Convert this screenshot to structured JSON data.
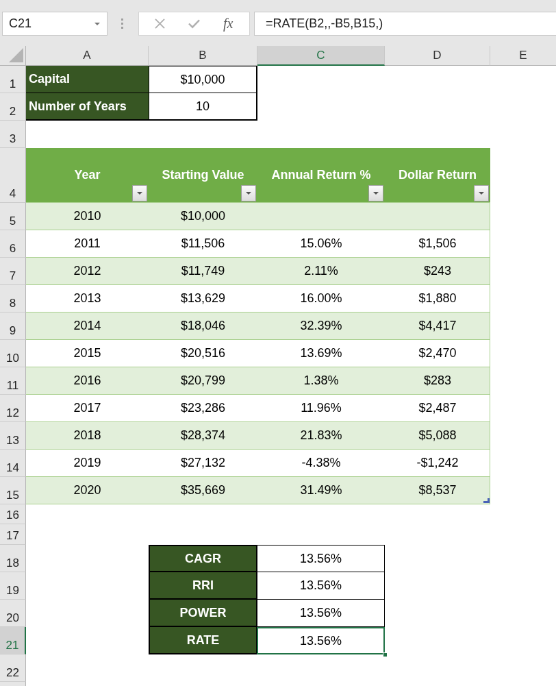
{
  "name_box": {
    "value": "C21"
  },
  "formula_buttons": [
    {
      "kind": "cancel",
      "disabled": true
    },
    {
      "kind": "enter",
      "disabled": true
    },
    {
      "kind": "function",
      "label": "fx",
      "disabled": false
    }
  ],
  "formula_bar": {
    "value": "=RATE(B2,,-B5,B15,)"
  },
  "columns": [
    {
      "label": "A",
      "selected": false
    },
    {
      "label": "B",
      "selected": false
    },
    {
      "label": "C",
      "selected": true
    },
    {
      "label": "D",
      "selected": false
    },
    {
      "label": "E",
      "selected": false
    }
  ],
  "row_headers": [
    {
      "label": "1",
      "selected": false
    },
    {
      "label": "2",
      "selected": false
    },
    {
      "label": "3",
      "selected": false
    },
    {
      "label": "4",
      "selected": false
    },
    {
      "label": "5",
      "selected": false
    },
    {
      "label": "6",
      "selected": false
    },
    {
      "label": "7",
      "selected": false
    },
    {
      "label": "8",
      "selected": false
    },
    {
      "label": "9",
      "selected": false
    },
    {
      "label": "10",
      "selected": false
    },
    {
      "label": "11",
      "selected": false
    },
    {
      "label": "12",
      "selected": false
    },
    {
      "label": "13",
      "selected": false
    },
    {
      "label": "14",
      "selected": false
    },
    {
      "label": "15",
      "selected": false
    },
    {
      "label": "16",
      "selected": false
    },
    {
      "label": "17",
      "selected": false
    },
    {
      "label": "18",
      "selected": false
    },
    {
      "label": "19",
      "selected": false
    },
    {
      "label": "20",
      "selected": false
    },
    {
      "label": "21",
      "selected": true
    },
    {
      "label": "22",
      "selected": false
    }
  ],
  "inputs": [
    {
      "label": "Capital",
      "value": "$10,000"
    },
    {
      "label": "Number of Years",
      "value": "10"
    }
  ],
  "table": {
    "columns": [
      "Year",
      "Starting Value",
      "Annual Return %",
      "Dollar Return"
    ],
    "rows": [
      [
        "2010",
        "$10,000"
      ],
      [
        "2011",
        "$11,506",
        "15.06%",
        "$1,506"
      ],
      [
        "2012",
        "$11,749",
        "2.11%",
        "$243"
      ],
      [
        "2013",
        "$13,629",
        "16.00%",
        "$1,880"
      ],
      [
        "2014",
        "$18,046",
        "32.39%",
        "$4,417"
      ],
      [
        "2015",
        "$20,516",
        "13.69%",
        "$2,470"
      ],
      [
        "2016",
        "$20,799",
        "1.38%",
        "$283"
      ],
      [
        "2017",
        "$23,286",
        "11.96%",
        "$2,487"
      ],
      [
        "2018",
        "$28,374",
        "21.83%",
        "$5,088"
      ],
      [
        "2019",
        "$27,132",
        "-4.38%",
        "-$1,242"
      ],
      [
        "2020",
        "$35,669",
        "31.49%",
        "$8,537"
      ]
    ]
  },
  "results": [
    {
      "label": "CAGR",
      "value": "13.56%",
      "selected": false
    },
    {
      "label": "RRI",
      "value": "13.56%",
      "selected": false
    },
    {
      "label": "POWER",
      "value": "13.56%",
      "selected": false
    },
    {
      "label": "RATE",
      "value": "13.56%",
      "selected": true
    }
  ]
}
